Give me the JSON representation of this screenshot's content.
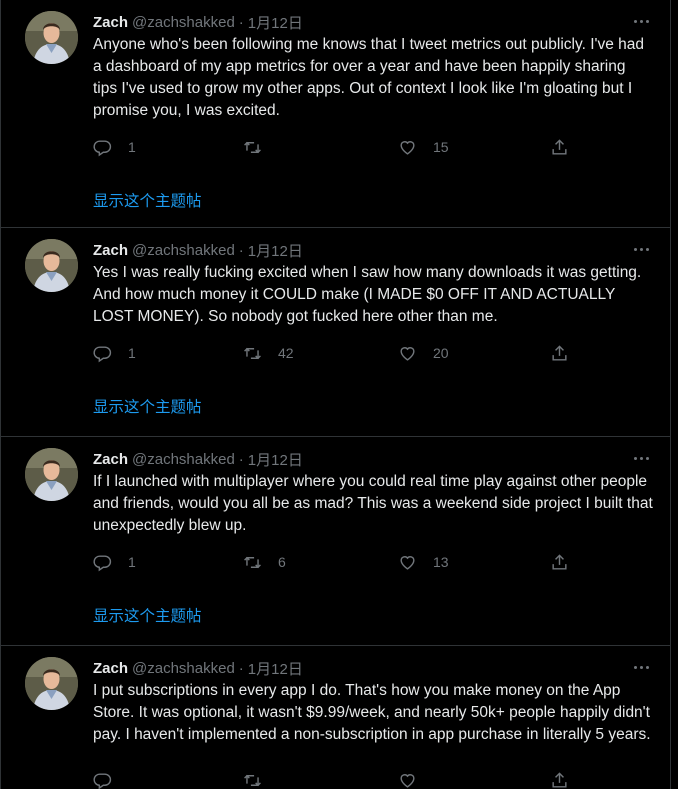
{
  "colors": {
    "background": "#000000",
    "text": "#e7e9ea",
    "muted": "#71767b",
    "link": "#1d9bf0",
    "divider": "#2f3336"
  },
  "icons": {
    "reply": "reply-icon",
    "retweet": "retweet-icon",
    "like": "heart-icon",
    "share": "share-icon",
    "more": "more-icon"
  },
  "tweets": [
    {
      "name": "Zach",
      "handle": "@zachshakked",
      "dot": "·",
      "date": "1月12日",
      "text": "Anyone who's been following me knows that I tweet metrics out publicly. I've had a dashboard of my app metrics for over a year and have been happily sharing tips I've used to grow my other apps. Out of context I look like I'm gloating but I promise you, I was excited.",
      "replies": "1",
      "retweets": "",
      "likes": "15",
      "show_thread": "显示这个主题帖"
    },
    {
      "name": "Zach",
      "handle": "@zachshakked",
      "dot": "·",
      "date": "1月12日",
      "text": "Yes I was really fucking excited when I saw how many downloads it was getting. And how much money it COULD make (I MADE $0 OFF IT AND ACTUALLY LOST MONEY). So nobody got fucked here other than me.",
      "replies": "1",
      "retweets": "42",
      "likes": "20",
      "show_thread": "显示这个主题帖"
    },
    {
      "name": "Zach",
      "handle": "@zachshakked",
      "dot": "·",
      "date": "1月12日",
      "text": "If I launched with multiplayer where you could real time play against other people and friends, would you all be as mad? This was a weekend side project I built that unexpectedly blew up.",
      "replies": "1",
      "retweets": "6",
      "likes": "13",
      "show_thread": "显示这个主题帖"
    },
    {
      "name": "Zach",
      "handle": "@zachshakked",
      "dot": "·",
      "date": "1月12日",
      "text": "I put subscriptions in every app I do. That's how you make money on the App Store. It was optional, it wasn't $9.99/week, and nearly 50k+ people happily didn't pay. I haven't implemented a non-subscription in app purchase in literally 5 years.",
      "replies": "",
      "retweets": "",
      "likes": "",
      "show_thread": ""
    }
  ]
}
